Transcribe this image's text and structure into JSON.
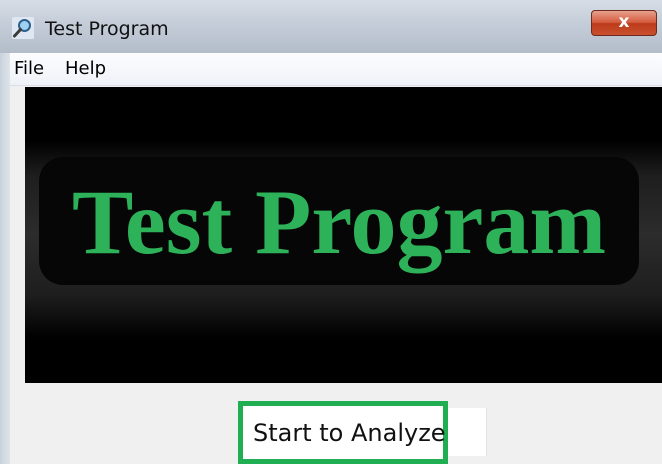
{
  "window": {
    "title": "Test Program",
    "close_glyph": "x",
    "close_color": "#c8502e"
  },
  "menu": {
    "items": [
      "File",
      "Help"
    ]
  },
  "banner": {
    "text": "Test Program",
    "text_color": "#2db25a"
  },
  "actions": {
    "analyze_label": "Start to Analyze",
    "highlight_color": "#1fae52"
  },
  "icons": {
    "app": "magnifier-icon"
  }
}
